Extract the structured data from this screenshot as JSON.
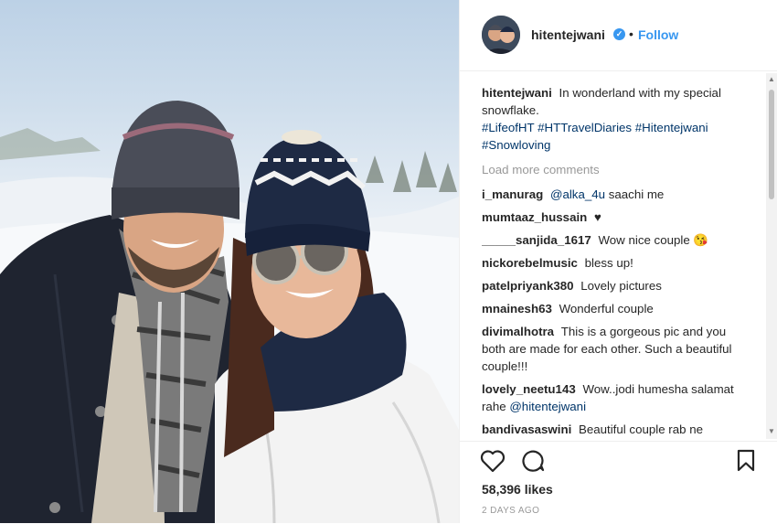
{
  "post": {
    "username": "hitentejwani",
    "verified_icon": "verified-badge-icon",
    "separator": "•",
    "follow_label": "Follow",
    "caption_user": "hitentejwani",
    "caption_text": "In wonderland with my special snowflake.",
    "hashtags": [
      "#LifeofHT",
      "#HTTravelDiaries",
      "#Hitentejwani",
      "#Snowloving"
    ],
    "load_more": "Load more comments",
    "comments": [
      {
        "user": "i_manurag",
        "mention": "@alka_4u",
        "text": " saachi me"
      },
      {
        "user": "mumtaaz_hussain",
        "text": "♥"
      },
      {
        "user": "_____sanjida_1617",
        "text": "Wow nice couple 😘"
      },
      {
        "user": "nickorebelmusic",
        "text": "bless up!"
      },
      {
        "user": "patelpriyank380",
        "text": "Lovely pictures"
      },
      {
        "user": "mnainesh63",
        "text": "Wonderful couple"
      },
      {
        "user": "divimalhotra",
        "text": "This is a gorgeous pic and you both are made for each other. Such a beautiful couple!!!"
      },
      {
        "user": "lovely_neetu143",
        "text": "Wow..jodi humesha salamat rahe ",
        "mention": "@hitentejwani"
      },
      {
        "user": "bandivasaswini",
        "text": "Beautiful couple rab ne"
      }
    ],
    "likes": "58,396 likes",
    "time": "2 DAYS AGO",
    "icons": [
      "heart-icon",
      "comment-icon",
      "bookmark-icon"
    ],
    "accent_color": "#3897f0"
  }
}
